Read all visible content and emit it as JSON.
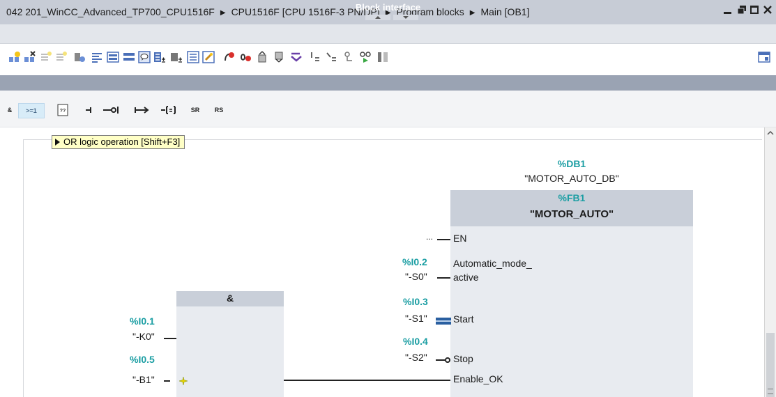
{
  "titlebar": {
    "segments": [
      "042 201_WinCC_Advanced_TP700_CPU1516F",
      "CPU1516F [CPU 1516F-3 PN/DP]",
      "Program blocks",
      "Main [OB1]"
    ],
    "separator": "▶",
    "controls": [
      "minimize",
      "restore",
      "float",
      "close"
    ]
  },
  "toolbar": {
    "icons": [
      "insert-network-icon",
      "delete-network-icon",
      "insert-row-icon",
      "add-row-icon",
      "show-symbols-icon",
      "network-comments-icon",
      "open-all-networks-icon",
      "close-all-networks-icon",
      "favorites-icon",
      "absolute-operands-icon",
      "tag-info-icon",
      "network-overview-icon",
      "zoom-icon",
      "favorites-edit-icon",
      "clear-breakpoints-icon",
      "clear-all-icon",
      "download-icon",
      "upload-icon",
      "compare-icon",
      "call-hierarchy-icon",
      "assign-icon",
      "monitor-icon",
      "glasses-icon",
      "status-icon",
      "window-icon"
    ]
  },
  "block_interface": {
    "label": "Block interface"
  },
  "instructions": {
    "items": [
      {
        "key": "and",
        "label": "&"
      },
      {
        "key": "or",
        "label": ">=1"
      },
      {
        "key": "box",
        "label": "[??]"
      },
      {
        "key": "branch_open",
        "label": "⊣"
      },
      {
        "key": "negate",
        "label": "–o|"
      },
      {
        "key": "branch_close",
        "label": "↦"
      },
      {
        "key": "assign",
        "label": "-[=]"
      },
      {
        "key": "sr",
        "label": "SR"
      },
      {
        "key": "rs",
        "label": "RS"
      }
    ]
  },
  "tooltip": {
    "text": "OR logic operation [Shift+F3]"
  },
  "fb": {
    "db_address": "%DB1",
    "db_name": "\"MOTOR_AUTO_DB\"",
    "address": "%FB1",
    "name": "\"MOTOR_AUTO\"",
    "pins": {
      "en": {
        "label": "EN",
        "operand": "..."
      },
      "automatic": {
        "label_line1": "Automatic_mode_",
        "label_line2": "active",
        "address": "%I0.2",
        "operand": "\"-S0\""
      },
      "start": {
        "label": "Start",
        "address": "%I0.3",
        "operand": "\"-S1\""
      },
      "stop": {
        "label": "Stop",
        "address": "%I0.4",
        "operand": "\"-S2\""
      },
      "enable": {
        "label": "Enable_OK"
      }
    }
  },
  "and_box": {
    "title": "&",
    "inputs": [
      {
        "address": "%I0.1",
        "operand": "\"-K0\""
      },
      {
        "address": "%I0.5",
        "operand": "\"-B1\""
      }
    ]
  },
  "colors": {
    "address": "#1b9ea3",
    "block_header": "#c9cfd9",
    "block_body": "#e8ebf0",
    "titlebar": "#c7ccd6",
    "tooltip": "#ffffc6",
    "block_interface_bar": "#9aa3b3"
  }
}
